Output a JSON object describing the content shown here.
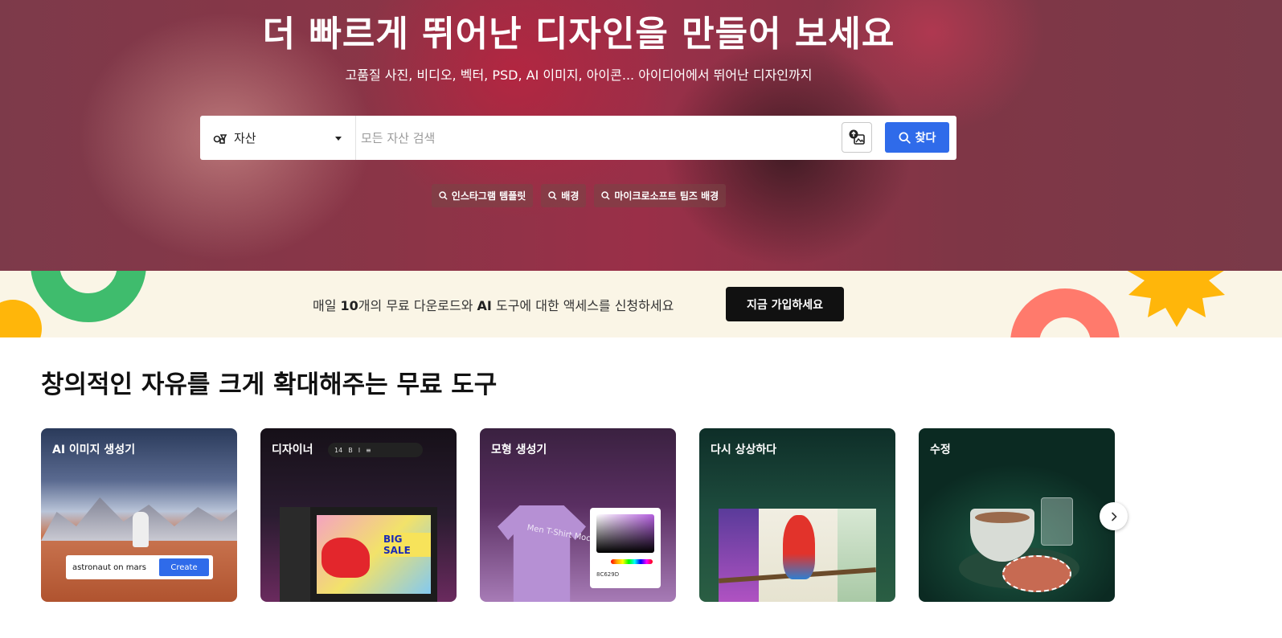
{
  "hero": {
    "title": "더 빠르게 뛰어난 디자인을 만들어 보세요",
    "subtitle": "고품질 사진, 비디오, 벡터, PSD, AI 이미지, 아이콘... 아이디어에서 뛰어난 디자인까지"
  },
  "search": {
    "asset_type": "자산",
    "placeholder": "모든 자산 검색",
    "button_label": "찾다",
    "suggestions": [
      "인스타그램 템플릿",
      "배경",
      "마이크로소프트 팀즈 배경"
    ]
  },
  "banner": {
    "text_prefix": "매일 ",
    "text_bold_count": "10",
    "text_mid": "개의 무료 다운로드와 ",
    "text_bold_ai": "AI",
    "text_suffix": " 도구에 대한 액세스를 신청하세요",
    "signup_label": "지금 가입하세요"
  },
  "tools": {
    "section_title": "창의적인 자유를 크게 확대해주는 무료 도구",
    "cards": [
      {
        "label": "AI 이미지 생성기",
        "prompt": "astronaut on mars",
        "action": "Create"
      },
      {
        "label": "디자이너",
        "font_size": "14",
        "sale_text": "BIG SALE"
      },
      {
        "label": "모형 생성기",
        "shirt_text": "Men T-Shirt Mockup",
        "hex": "8C629D"
      },
      {
        "label": "다시 상상하다"
      },
      {
        "label": "수정"
      }
    ]
  },
  "colors": {
    "primary": "#2f6bea",
    "banner_bg": "#faf5e6",
    "signup_bg": "#111111"
  }
}
